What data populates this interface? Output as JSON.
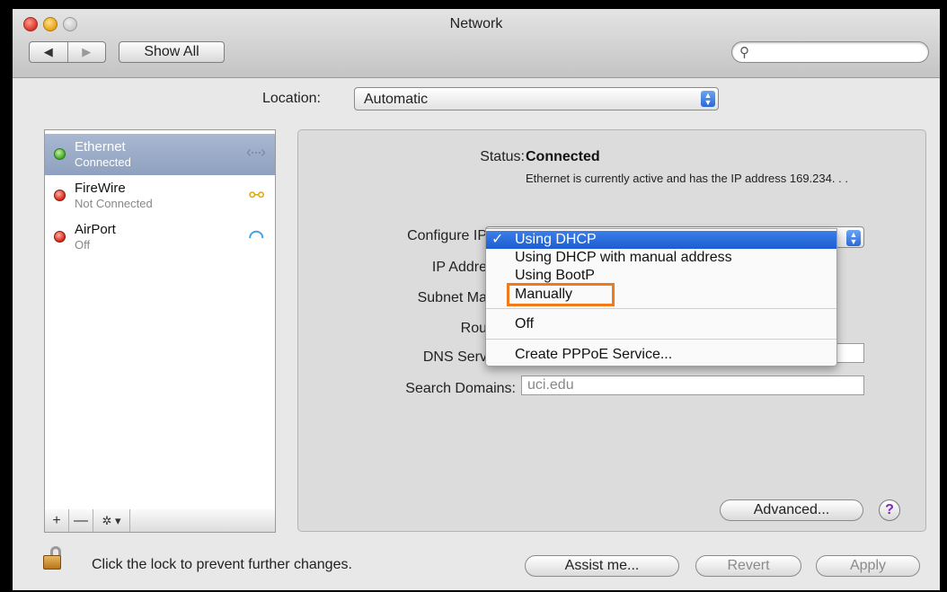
{
  "window": {
    "title": "Network"
  },
  "toolbar": {
    "back": "◀",
    "forward": "▶",
    "show_all": "Show All",
    "search_placeholder": ""
  },
  "location": {
    "label": "Location:",
    "value": "Automatic"
  },
  "services": [
    {
      "name": "Ethernet",
      "status": "Connected",
      "state_color": "#3fa82a",
      "icon": "ethernet-icon",
      "selected": true
    },
    {
      "name": "FireWire",
      "status": "Not Connected",
      "state_color": "#d4251a",
      "icon": "firewire-icon",
      "selected": false
    },
    {
      "name": "AirPort",
      "status": "Off",
      "state_color": "#d4251a",
      "icon": "wifi-icon",
      "selected": false
    }
  ],
  "list_toolbar": {
    "add": "+",
    "remove": "—",
    "gear": "✲ ▾"
  },
  "detail": {
    "status_label": "Status:",
    "status_value": "Connected",
    "status_desc": "Ethernet is currently active and has the IP address 169.234.",
    "status_desc_tail": ". .",
    "configure_label": "Configure IP",
    "ip_label": "IP Addre",
    "subnet_label": "Subnet Ma",
    "router_label": "Rou",
    "dns_label": "DNS Serv",
    "search_domains_label": "Search Domains:",
    "search_domains_value": "uci.edu"
  },
  "config_menu": {
    "items": [
      "Using DHCP",
      "Using DHCP with manual address",
      "Using BootP",
      "Manually",
      "Off",
      "Create PPPoE Service..."
    ],
    "selected": "Using DHCP",
    "check": "✓"
  },
  "buttons": {
    "advanced": "Advanced...",
    "help": "?",
    "assist": "Assist me...",
    "revert": "Revert",
    "apply": "Apply"
  },
  "lock": {
    "text": "Click the lock to prevent further changes."
  },
  "colors": {
    "selection_blue": "#1c5dd2",
    "highlight_orange": "#f07a1a"
  }
}
